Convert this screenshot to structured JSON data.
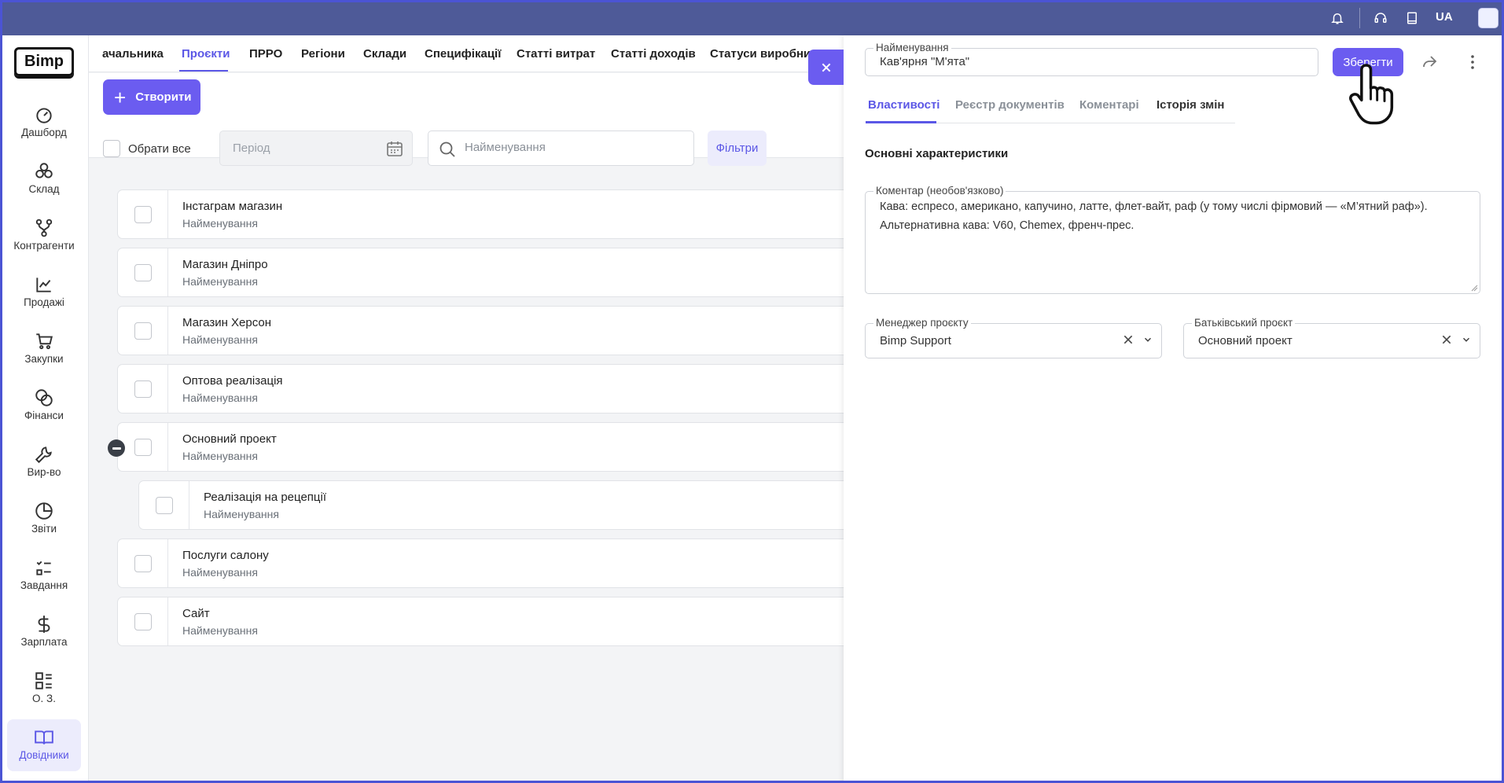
{
  "topbar": {
    "language": "UA",
    "icons": [
      "bell-icon",
      "headset-icon",
      "book-icon"
    ]
  },
  "sidebar": {
    "logo": "Bimp",
    "items": [
      {
        "label": "Дашборд",
        "icon": "gauge-icon"
      },
      {
        "label": "Склад",
        "icon": "boxes-icon"
      },
      {
        "label": "Контрагенти",
        "icon": "network-icon"
      },
      {
        "label": "Продажі",
        "icon": "chart-line-icon"
      },
      {
        "label": "Закупки",
        "icon": "cart-icon"
      },
      {
        "label": "Фінанси",
        "icon": "coins-icon"
      },
      {
        "label": "Вир-во",
        "icon": "wrench-icon"
      },
      {
        "label": "Звіти",
        "icon": "pie-icon"
      },
      {
        "label": "Завдання",
        "icon": "tasks-icon"
      },
      {
        "label": "Зарплата",
        "icon": "dollar-icon"
      },
      {
        "label": "О. З.",
        "icon": "grid-list-icon"
      },
      {
        "label": "Довідники",
        "icon": "open-book-icon"
      }
    ]
  },
  "tabs": [
    "ачальника",
    "Проєкти",
    "ПРРО",
    "Регіони",
    "Склади",
    "Специфікації",
    "Статті витрат",
    "Статті доходів",
    "Статуси виробниц"
  ],
  "toolbar": {
    "create_label": "Створити",
    "select_all_label": "Обрати все",
    "period_placeholder": "Період",
    "search_placeholder": "Найменування",
    "filters_label": "Фільтри"
  },
  "rows": [
    {
      "name": "Інстаграм магазин",
      "sub": "Найменування"
    },
    {
      "name": "Магазин Дніпро",
      "sub": "Найменування"
    },
    {
      "name": "Магазин Херсон",
      "sub": "Найменування"
    },
    {
      "name": "Оптова реалізація",
      "sub": "Найменування"
    },
    {
      "name": "Основний проект",
      "sub": "Найменування"
    },
    {
      "name": "Реалізація на рецепції",
      "sub": "Найменування"
    },
    {
      "name": "Послуги салону",
      "sub": "Найменування"
    },
    {
      "name": "Сайт",
      "sub": "Найменування"
    }
  ],
  "panel": {
    "name_label": "Найменування",
    "name_value": "Кав'ярня \"М'ята\"",
    "save_label": "Зберегти",
    "tabs": [
      "Властивості",
      "Реєстр документів",
      "Коментарі",
      "Історія змін"
    ],
    "section_title": "Основні характеристики",
    "comment_label": "Коментар (необов'язково)",
    "comment_lines": [
      "Кава: еспресо, американо, капучино, латте, флет-вайт, раф (у тому числі фірмовий — «М’ятний раф»).",
      "Альтернативна кава: V60, Chemex, френч-прес."
    ],
    "manager_label": "Менеджер проєкту",
    "manager_value": "Bimp Support",
    "parent_label": "Батьківський проєкт",
    "parent_value": "Основний проект"
  },
  "colors": {
    "accent": "#6b5cf0",
    "topbar": "#4e5a98",
    "active_text": "#5b57e6"
  }
}
